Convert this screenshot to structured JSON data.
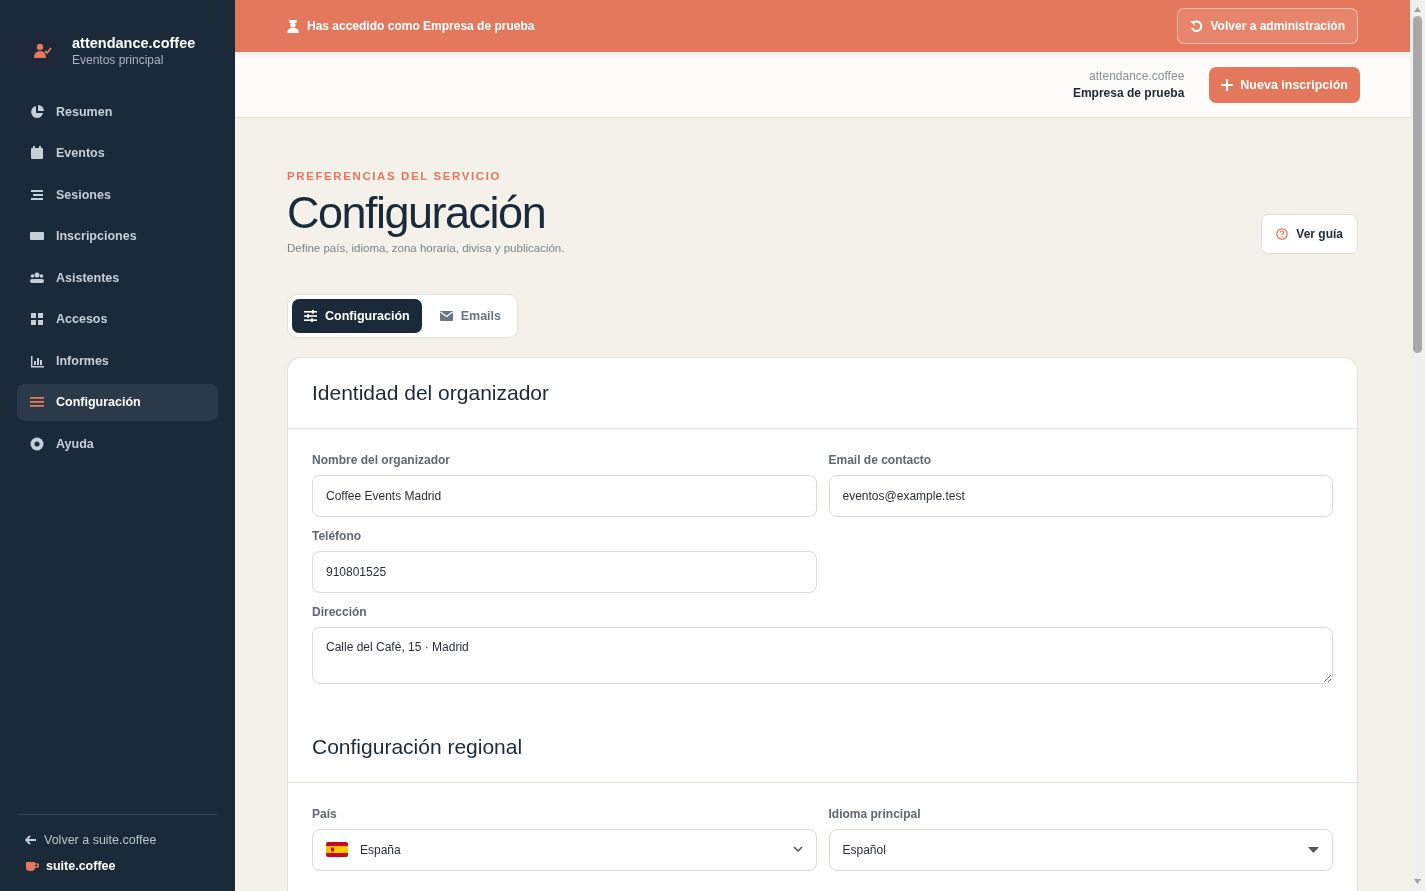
{
  "sidebar": {
    "brand": {
      "name": "attendance.coffee",
      "subtitle": "Eventos principal"
    },
    "items": [
      {
        "label": "Resumen",
        "selected": false
      },
      {
        "label": "Eventos",
        "selected": false
      },
      {
        "label": "Sesiones",
        "selected": false
      },
      {
        "label": "Inscripciones",
        "selected": false
      },
      {
        "label": "Asistentes",
        "selected": false
      },
      {
        "label": "Accesos",
        "selected": false
      },
      {
        "label": "Informes",
        "selected": false
      },
      {
        "label": "Configuración",
        "selected": true
      },
      {
        "label": "Ayuda",
        "selected": false
      }
    ],
    "back_link": "Volver a suite.coffee",
    "suite": "suite.coffee"
  },
  "banner": {
    "text": "Has accedido como Empresa de prueba",
    "button": "Volver a administración"
  },
  "header": {
    "app": "attendance.coffee",
    "company": "Empresa de prueba",
    "button": "Nueva inscripción"
  },
  "page": {
    "eyebrow": "PREFERENCIAS DEL SERVICIO",
    "title": "Configuración",
    "subtitle": "Define país, idioma, zona horaria, divisa y publicación.",
    "guide_button": "Ver guía"
  },
  "tabs": [
    {
      "label": "Configuración",
      "selected": true
    },
    {
      "label": "Emails",
      "selected": false
    }
  ],
  "sections": [
    {
      "title": "Identidad del organizador",
      "fields": [
        {
          "kind": "text",
          "label": "Nombre del organizador",
          "value": "Coffee Events Madrid"
        },
        {
          "kind": "text",
          "label": "Email de contacto",
          "value": "eventos@example.test"
        },
        {
          "kind": "text",
          "label": "Teléfono",
          "value": "910801525"
        },
        {
          "kind": "textarea",
          "label": "Dirección",
          "value": "Calle del Café, 15 · Madrid"
        }
      ]
    },
    {
      "title": "Configuración regional",
      "fields": [
        {
          "kind": "flag_select",
          "label": "País",
          "value": "España"
        },
        {
          "kind": "select",
          "label": "Idioma principal",
          "value": "Español"
        }
      ]
    }
  ]
}
